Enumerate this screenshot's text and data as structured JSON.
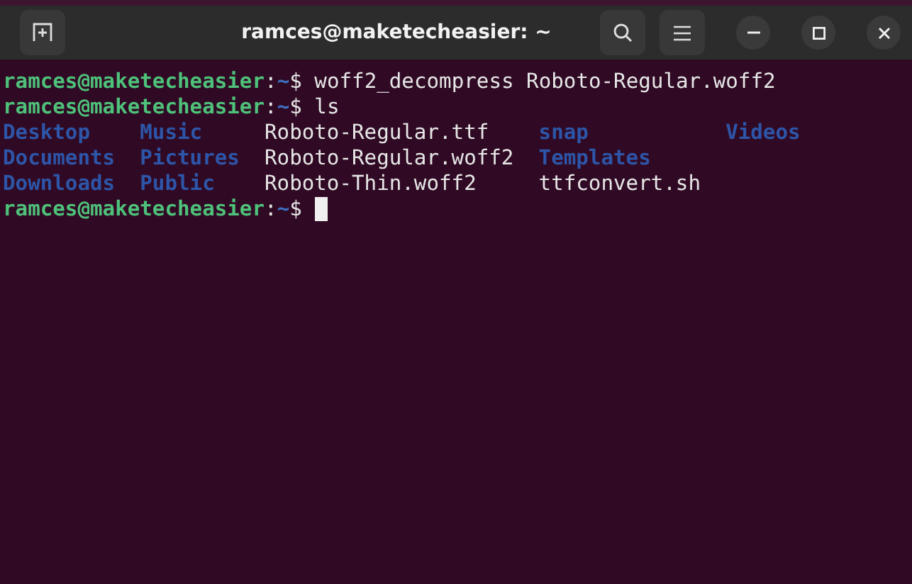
{
  "window": {
    "title": "ramces@maketecheasier: ~"
  },
  "terminal": {
    "lines": [
      {
        "kind": "prompt",
        "user": "ramces@maketecheasier",
        "colon": ":",
        "path": "~",
        "sign": "$",
        "command": "woff2_decompress Roboto-Regular.woff2",
        "cursor": false
      },
      {
        "kind": "prompt",
        "user": "ramces@maketecheasier",
        "colon": ":",
        "path": "~",
        "sign": "$",
        "command": "ls",
        "cursor": false
      },
      {
        "kind": "listing",
        "rows": [
          [
            {
              "name": "Desktop",
              "kind": "dir"
            },
            {
              "name": "Music",
              "kind": "dir"
            },
            {
              "name": "Roboto-Regular.ttf",
              "kind": "file"
            },
            {
              "name": "snap",
              "kind": "dir"
            },
            {
              "name": "Videos",
              "kind": "dir"
            }
          ],
          [
            {
              "name": "Documents",
              "kind": "dir"
            },
            {
              "name": "Pictures",
              "kind": "dir"
            },
            {
              "name": "Roboto-Regular.woff2",
              "kind": "file"
            },
            {
              "name": "Templates",
              "kind": "dir"
            }
          ],
          [
            {
              "name": "Downloads",
              "kind": "dir"
            },
            {
              "name": "Public",
              "kind": "dir"
            },
            {
              "name": "Roboto-Thin.woff2",
              "kind": "file"
            },
            {
              "name": "ttfconvert.sh",
              "kind": "file"
            }
          ]
        ]
      },
      {
        "kind": "prompt",
        "user": "ramces@maketecheasier",
        "colon": ":",
        "path": "~",
        "sign": "$",
        "cursor": true
      }
    ]
  }
}
